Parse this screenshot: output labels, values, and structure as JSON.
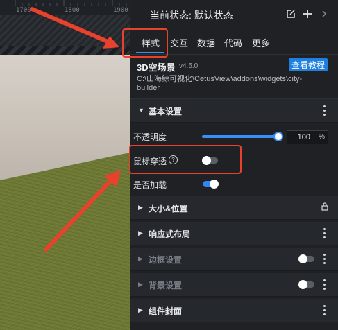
{
  "ruler": {
    "ticks": [
      "1700",
      "1800",
      "1900"
    ]
  },
  "status": {
    "label": "当前状态:  默认状态",
    "edit_icon": "edit-icon",
    "add_icon": "plus-icon",
    "next_icon": "chevron-right-icon"
  },
  "tabs": [
    {
      "label": "样式",
      "active": true
    },
    {
      "label": "交互"
    },
    {
      "label": "数据"
    },
    {
      "label": "代码"
    },
    {
      "label": "更多"
    }
  ],
  "component": {
    "name": "3D空场景",
    "version": "v4.5.0",
    "path": "C:\\山海鲸可视化\\CetusView\\addons\\widgets\\city-builder",
    "docs_button": "查看教程"
  },
  "basic": {
    "title": "基本设置",
    "opacity_label": "不透明度",
    "opacity_value": "100",
    "opacity_unit": "%",
    "opacity_level": 1.0,
    "mouse_through_label": "鼠标穿透",
    "mouse_through_on": false,
    "load_label": "是否加载",
    "load_on": true
  },
  "sections": [
    {
      "title": "大小&位置",
      "locked": true
    },
    {
      "title": "响应式布局"
    },
    {
      "title": "边框设置",
      "disabled": true,
      "toggle_on": false
    },
    {
      "title": "背景设置",
      "disabled": true,
      "toggle_on": false
    },
    {
      "title": "组件封面"
    }
  ],
  "colors": {
    "accent": "#3a8ef6",
    "highlight": "#e8412c",
    "panel": "#1f2125"
  }
}
